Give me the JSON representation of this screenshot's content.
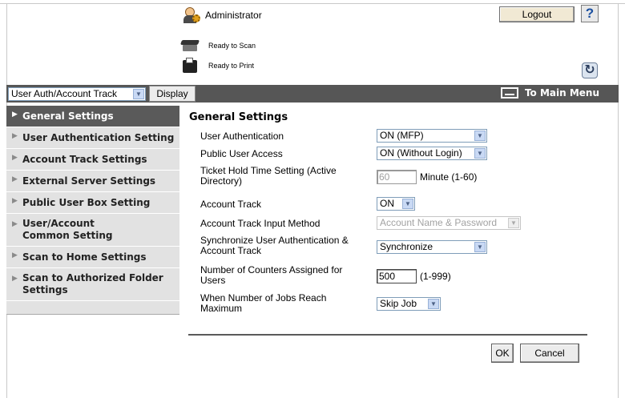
{
  "header": {
    "user": "Administrator",
    "logout_label": "Logout",
    "help_label": "?",
    "scanner_status": "Ready to Scan",
    "printer_status": "Ready to Print"
  },
  "toolbar": {
    "mode_value": "User Auth/Account Track",
    "display_label": "Display",
    "main_menu_label": "To Main Menu"
  },
  "sidebar": {
    "items": [
      {
        "label": "General Settings",
        "active": true
      },
      {
        "label": "User Authentication Setting"
      },
      {
        "label": "Account Track Settings"
      },
      {
        "label": "External Server Settings"
      },
      {
        "label": "Public User Box Setting"
      },
      {
        "label": "User/Account Common Setting"
      },
      {
        "label": "Scan to Home Settings"
      },
      {
        "label": "Scan to Authorized Folder Settings"
      }
    ]
  },
  "form": {
    "title": "General Settings",
    "rows": [
      {
        "label": "User Authentication",
        "value": "ON (MFP)"
      },
      {
        "label": "Public User Access",
        "value": "ON (Without Login)"
      },
      {
        "label": "Ticket Hold Time Setting (Active Directory)",
        "value": "60",
        "unit": "Minute (1-60)"
      },
      {
        "label": "Account Track",
        "value": "ON"
      },
      {
        "label": "Account Track Input Method",
        "value": "Account Name & Password"
      },
      {
        "label": "Synchronize User Authentication & Account Track",
        "value": "Synchronize"
      },
      {
        "label": "Number of Counters Assigned for Users",
        "value": "500",
        "unit": "(1-999)"
      },
      {
        "label": "When Number of Jobs Reach Maximum",
        "value": "Skip Job"
      }
    ],
    "ok_label": "OK",
    "cancel_label": "Cancel"
  },
  "colors": {
    "toolbar_bg": "#565656",
    "sidebar_bg": "#e2e2e2",
    "sidebar_active_bg": "#5a5a5a",
    "button_bg": "#ececec",
    "logout_bg": "#f1e9d4"
  }
}
